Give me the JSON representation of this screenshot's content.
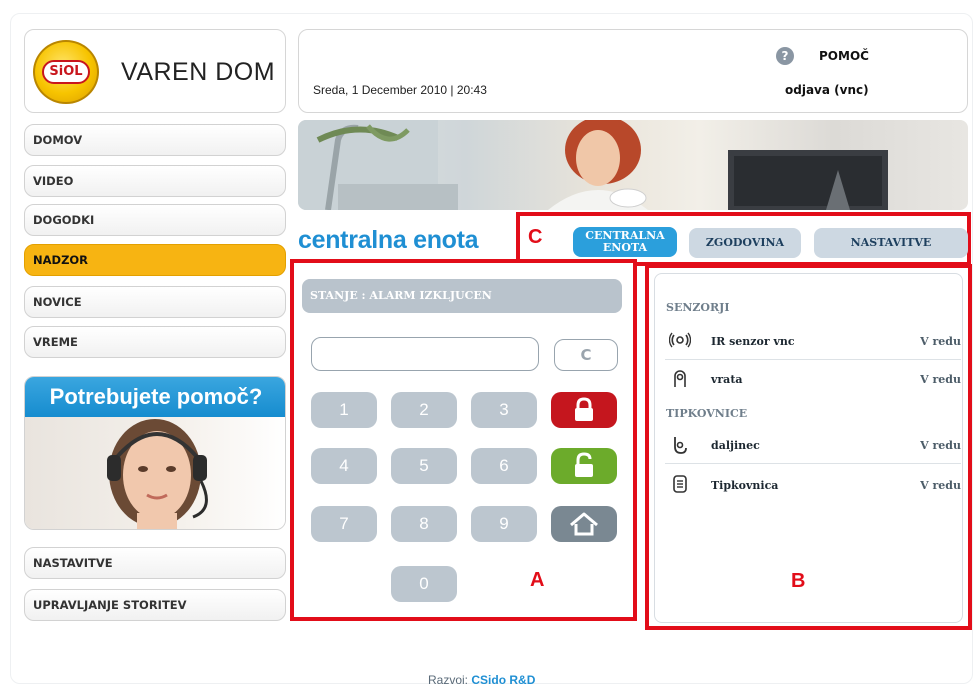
{
  "logo": {
    "brand": "SiOL",
    "title": "VAREN DOM"
  },
  "header": {
    "datetime": "Sreda, 1 December 2010 | 20:43",
    "help_label": "POMOČ",
    "logout_label": "odjava (vnc)"
  },
  "sidebar": {
    "items": [
      {
        "label": "DOMOV"
      },
      {
        "label": "VIDEO"
      },
      {
        "label": "DOGODKI"
      },
      {
        "label": "NADZOR",
        "active": true
      },
      {
        "label": "NOVICE"
      },
      {
        "label": "VREME"
      }
    ],
    "promo_title": "Potrebujete pomoč?",
    "bottom_items": [
      {
        "label": "NASTAVITVE"
      },
      {
        "label": "UPRAVLJANJE STORITEV"
      }
    ]
  },
  "main": {
    "title": "centralna enota",
    "tabs": [
      {
        "label": "CENTRALNA ENOTA",
        "active": true
      },
      {
        "label": "ZGODOVINA"
      },
      {
        "label": "NASTAVITVE"
      }
    ],
    "status": "STANJE : ALARM IZKLJUCEN",
    "keypad": {
      "input_value": "",
      "clear_label": "C",
      "keys": [
        "1",
        "2",
        "3",
        "4",
        "5",
        "6",
        "7",
        "8",
        "9",
        "0"
      ]
    },
    "sensors": {
      "group1_label": "SENZORJI",
      "group1": [
        {
          "name": "IR senzor vnc",
          "status": "V redu",
          "icon": "ir-sensor-icon"
        },
        {
          "name": "vrata",
          "status": "V redu",
          "icon": "door-sensor-icon"
        }
      ],
      "group2_label": "TIPKOVNICE",
      "group2": [
        {
          "name": "daljinec",
          "status": "V redu",
          "icon": "remote-icon"
        },
        {
          "name": "Tipkovnica",
          "status": "V redu",
          "icon": "keypad-icon"
        }
      ]
    }
  },
  "annotations": {
    "a": "A",
    "b": "B",
    "c": "C"
  },
  "footer": {
    "prefix": "Razvoj:",
    "name": "CSido R&D"
  },
  "colors": {
    "accent": "#1f8fd3",
    "active_nav": "#f7b412",
    "annotation": "#e20d19"
  }
}
